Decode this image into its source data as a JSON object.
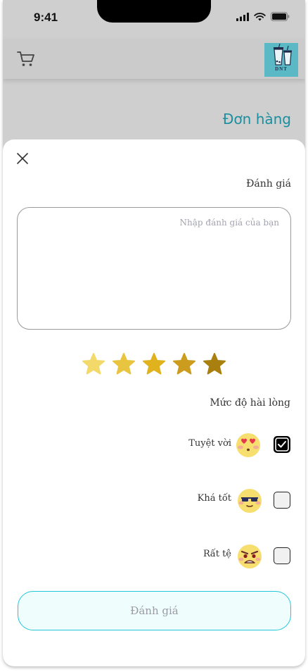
{
  "status_bar": {
    "time": "9:41"
  },
  "header": {
    "logo_text": "DNT"
  },
  "page": {
    "title": "Đơn hàng"
  },
  "review_sheet": {
    "title": "Đánh giá",
    "review_placeholder": "Nhập đánh giá của bạn",
    "rating": {
      "stars": 5,
      "colors": [
        "#f3d96a",
        "#e9c440",
        "#e0b21e",
        "#cb9c1d",
        "#a9800f"
      ]
    },
    "satisfaction_label": "Mức độ hài lòng",
    "options": [
      {
        "label": "Tuyệt vời",
        "emoji": "heart-eyes-emoji",
        "checked": true
      },
      {
        "label": "Khá tốt",
        "emoji": "cool-sunglasses-emoji",
        "checked": false
      },
      {
        "label": "Rất tệ",
        "emoji": "angry-emoji",
        "checked": false
      }
    ],
    "submit_label": "Đánh giá"
  },
  "colors": {
    "accent": "#1b8fa0",
    "button_border": "#22c6d8",
    "button_bg": "#effdfd"
  }
}
